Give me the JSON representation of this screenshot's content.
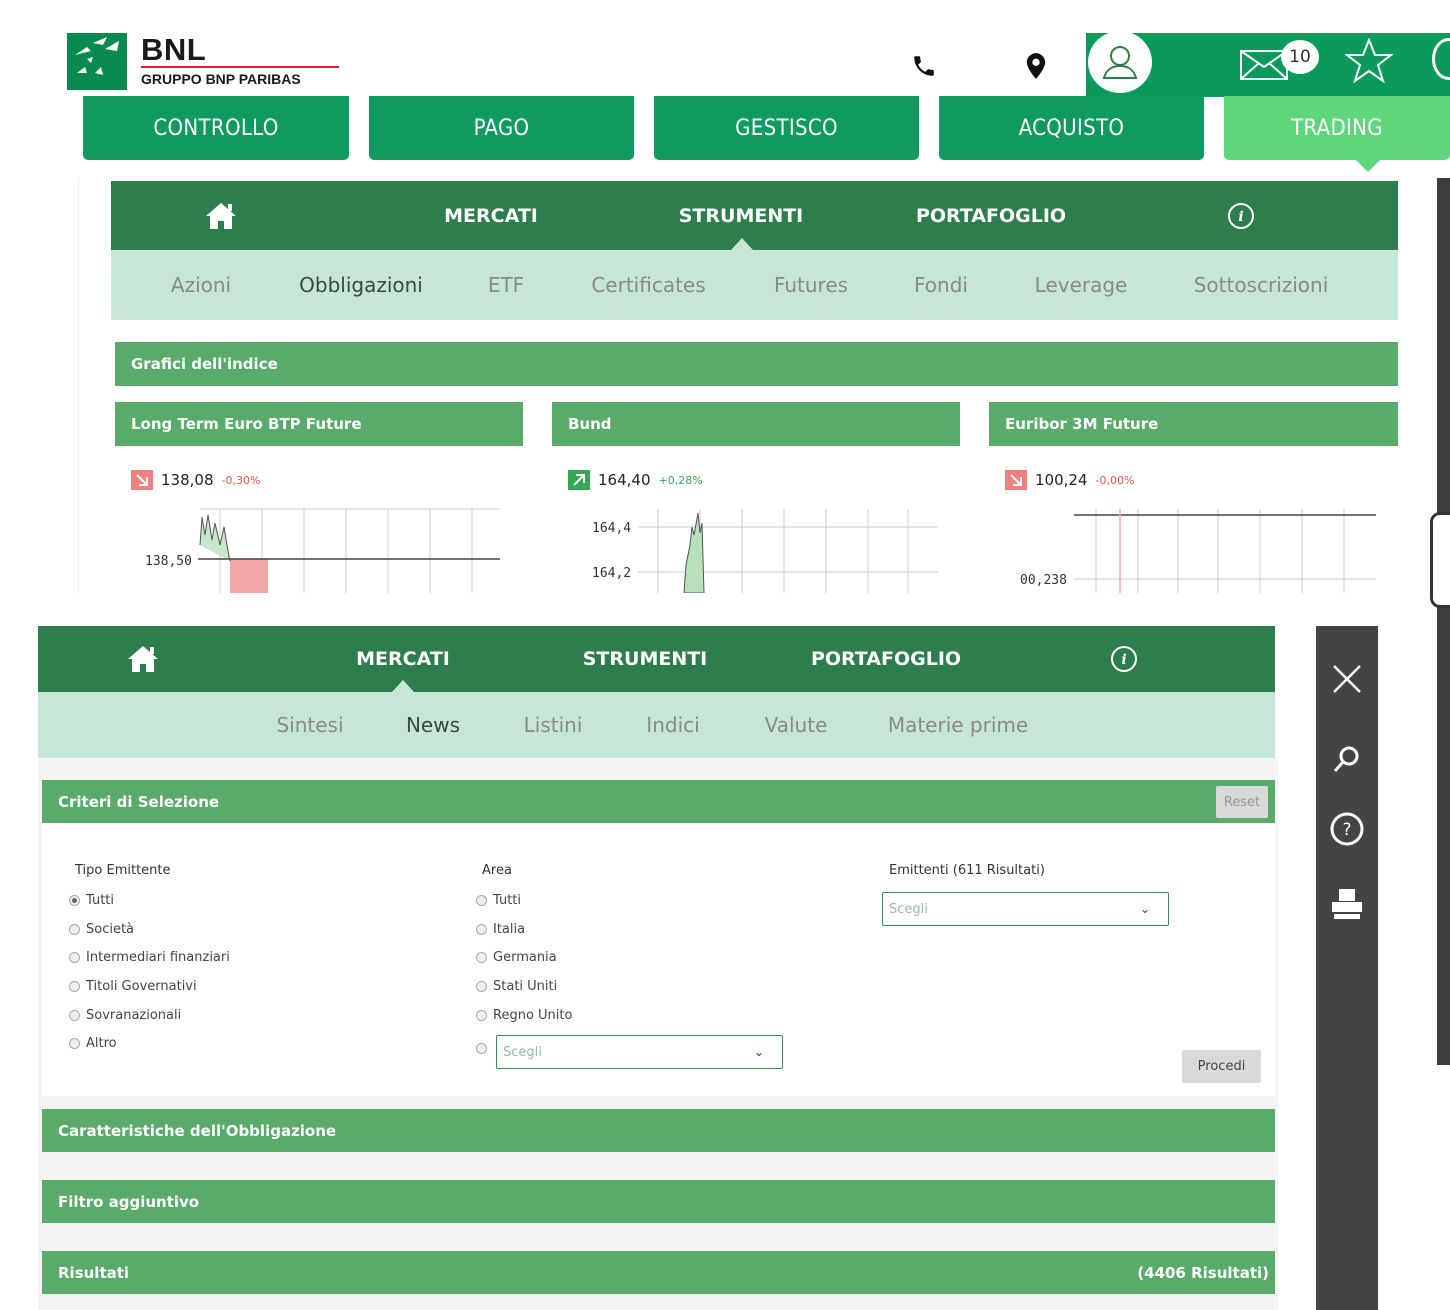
{
  "header": {
    "brand": "BNL",
    "brand_sub": "GRUPPO BNP PARIBAS",
    "mail_count": "10",
    "icons": [
      "phone-icon",
      "location-pin-icon",
      "user-icon",
      "mail-icon",
      "star-icon"
    ]
  },
  "main_tabs": [
    "CONTROLLO",
    "PAGO",
    "GESTISCO",
    "ACQUISTO",
    "TRADING"
  ],
  "panel1": {
    "nav": {
      "mercati": "MERCATI",
      "strumenti": "STRUMENTI",
      "portafoglio": "PORTAFOGLIO"
    },
    "subnav": [
      "Azioni",
      "Obbligazioni",
      "ETF",
      "Certificates",
      "Futures",
      "Fondi",
      "Leverage",
      "Sottoscrizioni"
    ],
    "active_subnav": "Obbligazioni",
    "section_title": "Grafici dell'indice",
    "cards": [
      {
        "title": "Long Term Euro BTP Future",
        "value": "138,08",
        "change": "-0,30%",
        "direction": "down",
        "axis_label": "138,50"
      },
      {
        "title": "Bund",
        "value": "164,40",
        "change": "+0,28%",
        "direction": "up",
        "axis_labels": [
          "164,4",
          "164,2"
        ]
      },
      {
        "title": "Euribor 3M Future",
        "value": "100,24",
        "change": "-0,00%",
        "direction": "down",
        "axis_label": "00,238"
      }
    ]
  },
  "panel2": {
    "nav": {
      "mercati": "MERCATI",
      "strumenti": "STRUMENTI",
      "portafoglio": "PORTAFOGLIO"
    },
    "subnav": [
      "Sintesi",
      "News",
      "Listini",
      "Indici",
      "Valute",
      "Materie prime"
    ],
    "active_subnav": "News",
    "criteria": {
      "title": "Criteri di Selezione",
      "reset": "Reset",
      "tipo_label": "Tipo Emittente",
      "tipo_options": [
        "Tutti",
        "Società",
        "Intermediari finanziari",
        "Titoli Governativi",
        "Sovranazionali",
        "Altro"
      ],
      "area_label": "Area",
      "area_options": [
        "Tutti",
        "Italia",
        "Germania",
        "Stati Uniti",
        "Regno Unito"
      ],
      "area_select_placeholder": "Scegli",
      "emittenti_label": "Emittenti (611 Risultati)",
      "emittenti_placeholder": "Scegli",
      "procedi": "Procedi"
    },
    "sections": {
      "caratteristiche": "Caratteristiche dell'Obbligazione",
      "filtro": "Filtro aggiuntivo",
      "risultati": "Risultati",
      "risultati_count": "(4406 Risultati)"
    }
  },
  "sidebar_icons": [
    "close-icon",
    "search-icon",
    "help-icon",
    "print-icon"
  ],
  "colors": {
    "dark_green": "#2e7d4c",
    "tab_green": "#0f9b5f",
    "bar_green": "#5aab6b",
    "light_green": "#c6e6d6",
    "active_tab": "#5fd67c"
  }
}
